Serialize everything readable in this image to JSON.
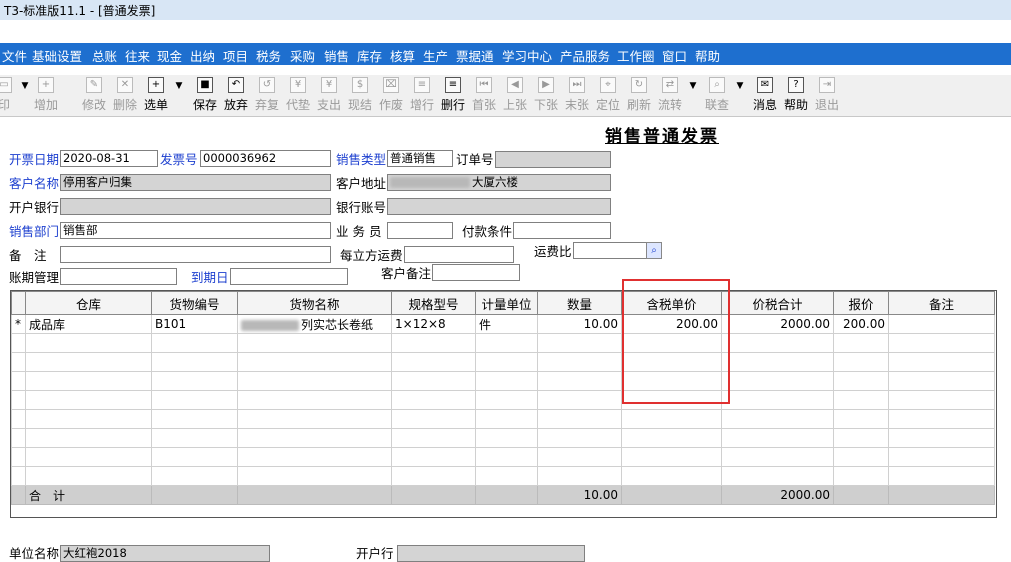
{
  "window": {
    "title": "T3-标准版11.1 - [普通发票]"
  },
  "menu": [
    "文件",
    "基础设置",
    "总账",
    "往来",
    "现金",
    "出纳",
    "项目",
    "税务",
    "采购",
    "销售",
    "库存",
    "核算",
    "生产",
    "票据通",
    "学习中心",
    "产品服务",
    "工作圈",
    "窗口",
    "帮助"
  ],
  "toolbar": {
    "print": "印",
    "add": "增加",
    "edit": "修改",
    "delete": "删除",
    "select": "选单",
    "save": "保存",
    "discard": "放弃",
    "restore": "弃复",
    "advance": "代垫",
    "pay": "支出",
    "settle": "现结",
    "void": "作废",
    "add_row": "增行",
    "del_row": "删行",
    "first": "首张",
    "prev": "上张",
    "next": "下张",
    "last": "末张",
    "locate": "定位",
    "refresh": "刷新",
    "flow": "流转",
    "query": "联查",
    "message": "消息",
    "help": "帮助",
    "exit": "退出"
  },
  "form": {
    "title": "销售普通发票",
    "invoice_date_label": "开票日期",
    "invoice_date": "2020-08-31",
    "invoice_no_label": "发票号",
    "invoice_no": "0000036962",
    "sales_type_label": "销售类型",
    "sales_type": "普通销售",
    "order_no_label": "订单号",
    "order_no": "",
    "customer_label": "客户名称",
    "customer": "停用客户归集",
    "address_label": "客户地址",
    "address_suffix": "大厦六楼",
    "bank_label": "开户银行",
    "bank": "",
    "account_label": "银行账号",
    "account": "",
    "dept_label": "销售部门",
    "dept": "销售部",
    "salesman_label": "业 务 员",
    "salesman": "",
    "payment_label": "付款条件",
    "payment": "",
    "remark_label": "备　注",
    "remark": "",
    "freight_label": "每立方运费",
    "freight": "",
    "freight_ratio_label": "运费比",
    "freight_ratio": "",
    "acct_mgmt_label": "账期管理",
    "acct_mgmt": "",
    "due_date_label": "到期日",
    "due_date": "",
    "cust_remark_label": "客户备注",
    "cust_remark": "",
    "unit_name_label": "单位名称",
    "unit_name": "大红袍2018",
    "bank2_label": "开户行",
    "bank2": ""
  },
  "grid": {
    "headers": [
      "仓库",
      "货物编号",
      "货物名称",
      "规格型号",
      "计量单位",
      "数量",
      "含税单价",
      "价税合计",
      "报价",
      "备注"
    ],
    "rows": [
      {
        "marker": "*",
        "warehouse": "成品库",
        "code": "B101",
        "name_suffix": "列实芯长卷纸",
        "spec": "1×12×8",
        "unit": "件",
        "qty": "10.00",
        "unit_price": "200.00",
        "total": "2000.00",
        "quote": "200.00",
        "note": ""
      }
    ],
    "sum_label": "合　计",
    "sum_qty": "10.00",
    "sum_total": "2000.00"
  },
  "colors": {
    "menu_bg": "#1e6fcf",
    "highlight": "#e03030",
    "label_blue": "#1c3fcf"
  }
}
